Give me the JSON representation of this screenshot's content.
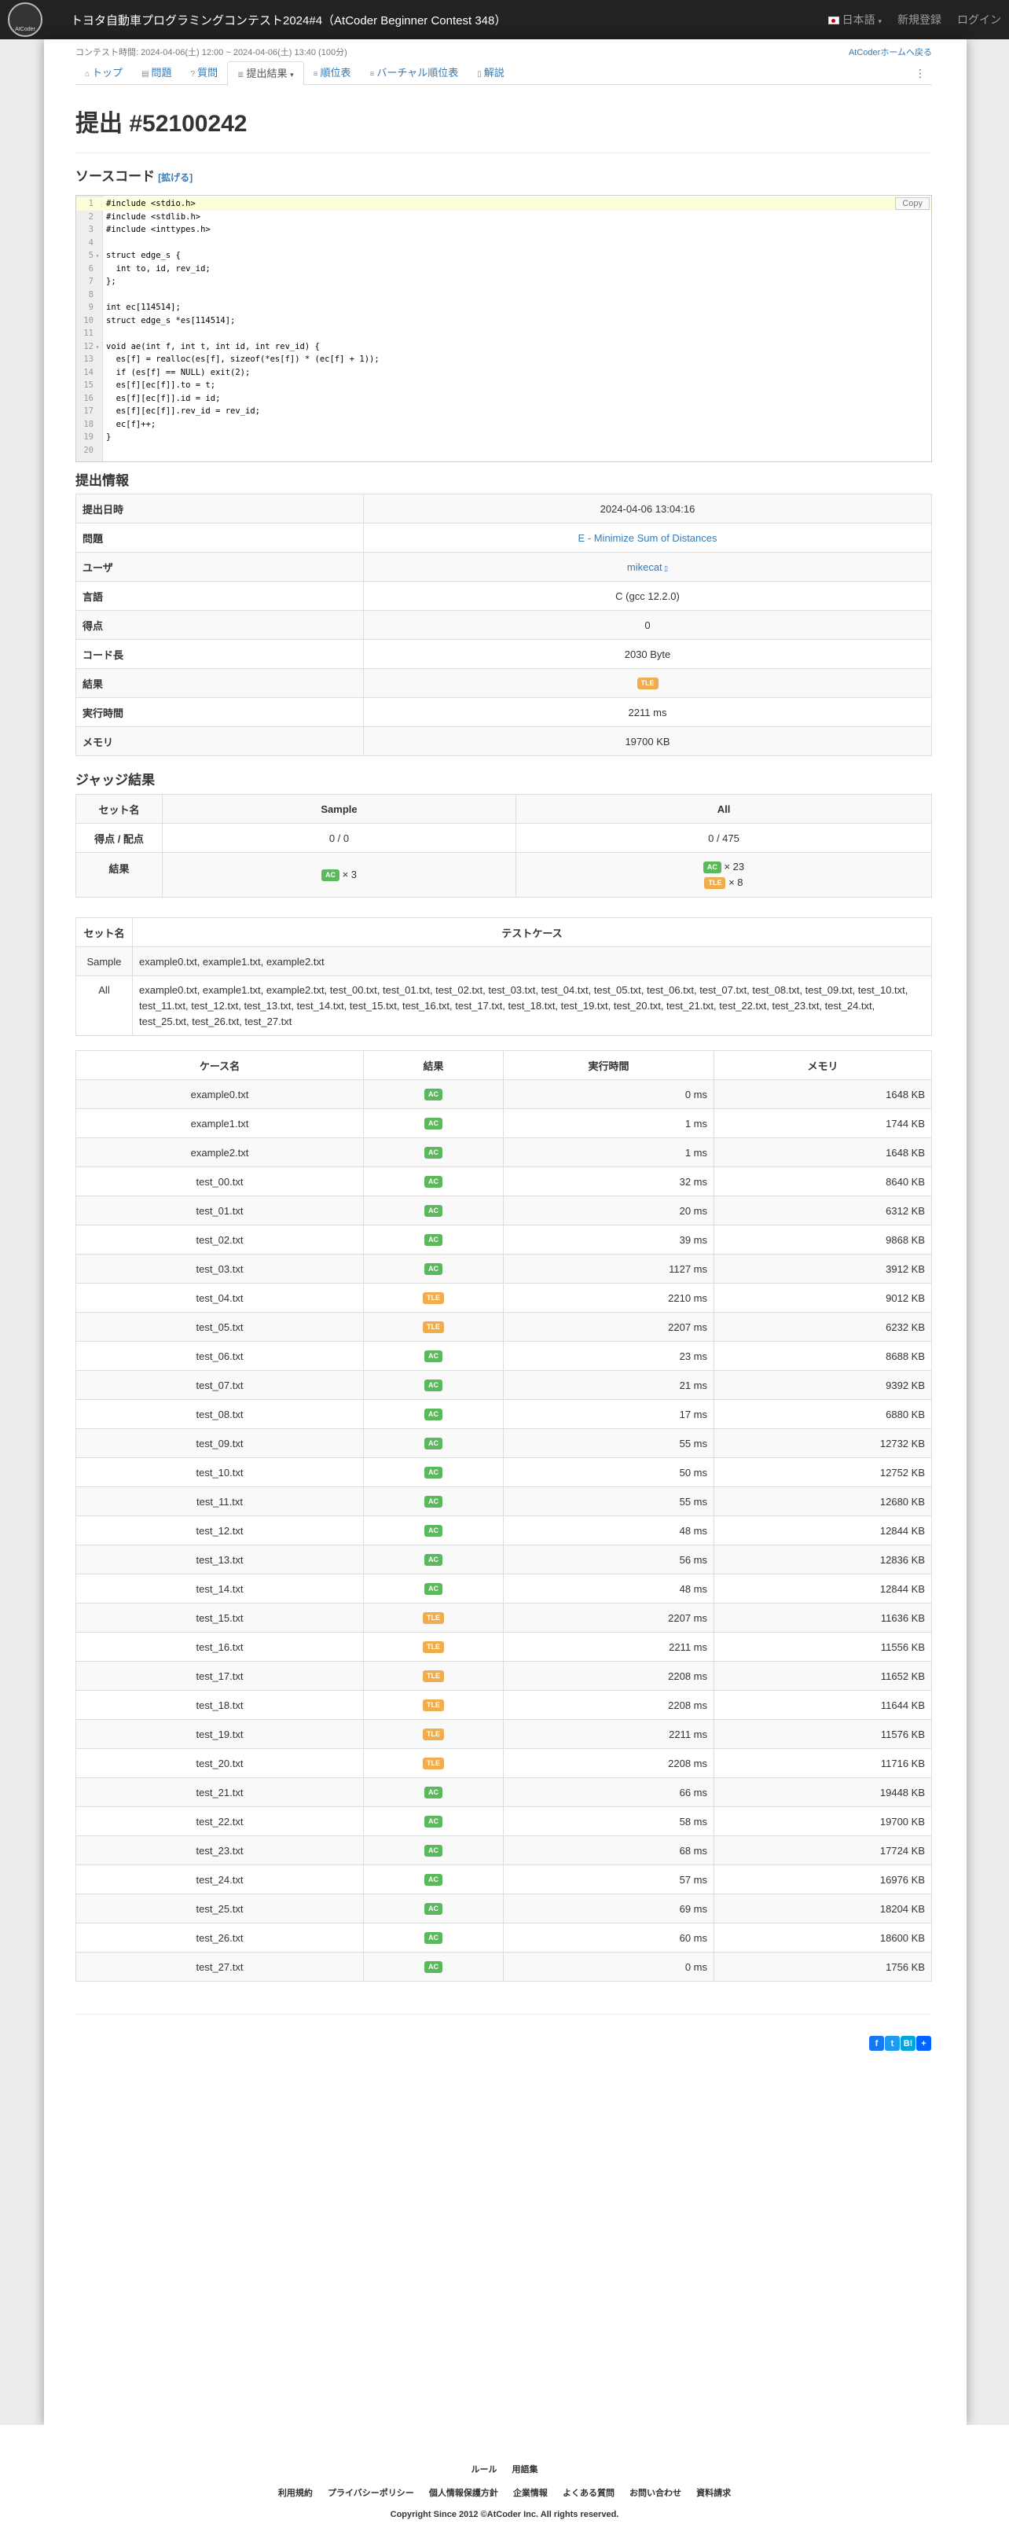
{
  "navbar": {
    "title": "トヨタ自動車プログラミングコンテスト2024#4（AtCoder Beginner Contest 348）",
    "logo_text": "AtCoder",
    "language": "日本語",
    "register": "新規登録",
    "login": "ログイン"
  },
  "contest_time": "コンテスト時間: 2024-04-06(土) 12:00 ~ 2024-04-06(土) 13:40 (100分)",
  "back_link": "AtCoderホームへ戻る",
  "tabs": [
    {
      "label": "トップ"
    },
    {
      "label": "問題"
    },
    {
      "label": "質問"
    },
    {
      "label": "提出結果"
    },
    {
      "label": "順位表"
    },
    {
      "label": "バーチャル順位表"
    },
    {
      "label": "解説"
    }
  ],
  "page_title": "提出 #52100242",
  "source": {
    "title": "ソースコード",
    "expand": "[拡げる]",
    "copy": "Copy",
    "lines": [
      "#include <stdio.h>",
      "#include <stdlib.h>",
      "#include <inttypes.h>",
      "",
      "struct edge_s {",
      "  int to, id, rev_id;",
      "};",
      "",
      "int ec[114514];",
      "struct edge_s *es[114514];",
      "",
      "void ae(int f, int t, int id, int rev_id) {",
      "  es[f] = realloc(es[f], sizeof(*es[f]) * (ec[f] + 1));",
      "  if (es[f] == NULL) exit(2);",
      "  es[f][ec[f]].to = t;",
      "  es[f][ec[f]].id = id;",
      "  es[f][ec[f]].rev_id = rev_id;",
      "  ec[f]++;",
      "}",
      ""
    ]
  },
  "info": {
    "title": "提出情報",
    "rows": [
      {
        "label": "提出日時",
        "value": "2024-04-06 13:04:16"
      },
      {
        "label": "問題",
        "value": "E - Minimize Sum of Distances"
      },
      {
        "label": "ユーザ",
        "value": "mikecat"
      },
      {
        "label": "言語",
        "value": "C (gcc 12.2.0)"
      },
      {
        "label": "得点",
        "value": "0"
      },
      {
        "label": "コード長",
        "value": "2030 Byte"
      },
      {
        "label": "結果",
        "value": "TLE"
      },
      {
        "label": "実行時間",
        "value": "2211 ms"
      },
      {
        "label": "メモリ",
        "value": "19700 KB"
      }
    ]
  },
  "judge": {
    "title": "ジャッジ結果",
    "headers": [
      "セット名",
      "Sample",
      "All"
    ],
    "score_label": "得点 / 配点",
    "score_sample": "0 / 0",
    "score_all": "0 / 475",
    "result_label": "結果",
    "sample_ac": "AC",
    "sample_ac_count": "× 3",
    "all_ac": "AC",
    "all_ac_count": "× 23",
    "all_tle": "TLE",
    "all_tle_count": "× 8"
  },
  "sets": {
    "headers": [
      "セット名",
      "テストケース"
    ],
    "rows": [
      {
        "name": "Sample",
        "cases": "example0.txt, example1.txt, example2.txt"
      },
      {
        "name": "All",
        "cases": "example0.txt, example1.txt, example2.txt, test_00.txt, test_01.txt, test_02.txt, test_03.txt, test_04.txt, test_05.txt, test_06.txt, test_07.txt, test_08.txt, test_09.txt, test_10.txt, test_11.txt, test_12.txt, test_13.txt, test_14.txt, test_15.txt, test_16.txt, test_17.txt, test_18.txt, test_19.txt, test_20.txt, test_21.txt, test_22.txt, test_23.txt, test_24.txt, test_25.txt, test_26.txt, test_27.txt"
      }
    ]
  },
  "cases": {
    "headers": [
      "ケース名",
      "結果",
      "実行時間",
      "メモリ"
    ],
    "rows": [
      {
        "name": "example0.txt",
        "result": "AC",
        "time": "0 ms",
        "memory": "1648 KB"
      },
      {
        "name": "example1.txt",
        "result": "AC",
        "time": "1 ms",
        "memory": "1744 KB"
      },
      {
        "name": "example2.txt",
        "result": "AC",
        "time": "1 ms",
        "memory": "1648 KB"
      },
      {
        "name": "test_00.txt",
        "result": "AC",
        "time": "32 ms",
        "memory": "8640 KB"
      },
      {
        "name": "test_01.txt",
        "result": "AC",
        "time": "20 ms",
        "memory": "6312 KB"
      },
      {
        "name": "test_02.txt",
        "result": "AC",
        "time": "39 ms",
        "memory": "9868 KB"
      },
      {
        "name": "test_03.txt",
        "result": "AC",
        "time": "1127 ms",
        "memory": "3912 KB"
      },
      {
        "name": "test_04.txt",
        "result": "TLE",
        "time": "2210 ms",
        "memory": "9012 KB"
      },
      {
        "name": "test_05.txt",
        "result": "TLE",
        "time": "2207 ms",
        "memory": "6232 KB"
      },
      {
        "name": "test_06.txt",
        "result": "AC",
        "time": "23 ms",
        "memory": "8688 KB"
      },
      {
        "name": "test_07.txt",
        "result": "AC",
        "time": "21 ms",
        "memory": "9392 KB"
      },
      {
        "name": "test_08.txt",
        "result": "AC",
        "time": "17 ms",
        "memory": "6880 KB"
      },
      {
        "name": "test_09.txt",
        "result": "AC",
        "time": "55 ms",
        "memory": "12732 KB"
      },
      {
        "name": "test_10.txt",
        "result": "AC",
        "time": "50 ms",
        "memory": "12752 KB"
      },
      {
        "name": "test_11.txt",
        "result": "AC",
        "time": "55 ms",
        "memory": "12680 KB"
      },
      {
        "name": "test_12.txt",
        "result": "AC",
        "time": "48 ms",
        "memory": "12844 KB"
      },
      {
        "name": "test_13.txt",
        "result": "AC",
        "time": "56 ms",
        "memory": "12836 KB"
      },
      {
        "name": "test_14.txt",
        "result": "AC",
        "time": "48 ms",
        "memory": "12844 KB"
      },
      {
        "name": "test_15.txt",
        "result": "TLE",
        "time": "2207 ms",
        "memory": "11636 KB"
      },
      {
        "name": "test_16.txt",
        "result": "TLE",
        "time": "2211 ms",
        "memory": "11556 KB"
      },
      {
        "name": "test_17.txt",
        "result": "TLE",
        "time": "2208 ms",
        "memory": "11652 KB"
      },
      {
        "name": "test_18.txt",
        "result": "TLE",
        "time": "2208 ms",
        "memory": "11644 KB"
      },
      {
        "name": "test_19.txt",
        "result": "TLE",
        "time": "2211 ms",
        "memory": "11576 KB"
      },
      {
        "name": "test_20.txt",
        "result": "TLE",
        "time": "2208 ms",
        "memory": "11716 KB"
      },
      {
        "name": "test_21.txt",
        "result": "AC",
        "time": "66 ms",
        "memory": "19448 KB"
      },
      {
        "name": "test_22.txt",
        "result": "AC",
        "time": "58 ms",
        "memory": "19700 KB"
      },
      {
        "name": "test_23.txt",
        "result": "AC",
        "time": "68 ms",
        "memory": "17724 KB"
      },
      {
        "name": "test_24.txt",
        "result": "AC",
        "time": "57 ms",
        "memory": "16976 KB"
      },
      {
        "name": "test_25.txt",
        "result": "AC",
        "time": "69 ms",
        "memory": "18204 KB"
      },
      {
        "name": "test_26.txt",
        "result": "AC",
        "time": "60 ms",
        "memory": "18600 KB"
      },
      {
        "name": "test_27.txt",
        "result": "AC",
        "time": "0 ms",
        "memory": "1756 KB"
      }
    ]
  },
  "footer": {
    "row1": [
      "ルール",
      "用語集"
    ],
    "row2": [
      "利用規約",
      "プライバシーポリシー",
      "個人情報保護方針",
      "企業情報",
      "よくある質問",
      "お問い合わせ",
      "資料請求"
    ],
    "copyright": "Copyright Since 2012 ©AtCoder Inc. All rights reserved."
  },
  "colors": {
    "ac": "#5cb85c",
    "tle": "#f0ad4e",
    "link": "#337ab7",
    "navbar": "#222222"
  }
}
